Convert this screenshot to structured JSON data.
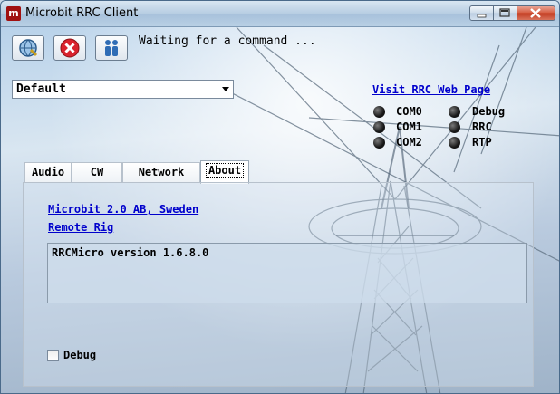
{
  "window": {
    "title": "Microbit RRC Client",
    "app_icon_letter": "m"
  },
  "toolbar": {
    "status_text": "Waiting for a command ..."
  },
  "profile": {
    "selected": "Default"
  },
  "web_link": "Visit RRC Web Page",
  "indicators": {
    "left": [
      {
        "label": "COM0"
      },
      {
        "label": "COM1"
      },
      {
        "label": "COM2"
      }
    ],
    "right": [
      {
        "label": "Debug"
      },
      {
        "label": "RRC"
      },
      {
        "label": "RTP"
      }
    ]
  },
  "tabs": [
    {
      "label": "Audio"
    },
    {
      "label": "CW"
    },
    {
      "label": "Network"
    },
    {
      "label": "About"
    }
  ],
  "active_tab": "About",
  "about": {
    "company_link": "Microbit 2.0 AB, Sweden",
    "remote_rig_link": "Remote Rig",
    "version_text": "RRCMicro version 1.6.8.0"
  },
  "debug_checkbox": {
    "label": "Debug",
    "checked": false
  }
}
